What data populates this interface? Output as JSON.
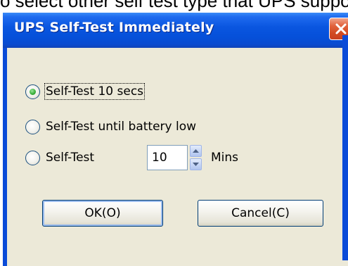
{
  "top_text": "o select other self test type that UPS support",
  "dialog": {
    "title": "UPS Self-Test Immediately",
    "close_icon": "close-x-icon"
  },
  "options": [
    {
      "label": "Self-Test 10 secs",
      "checked": true
    },
    {
      "label": "Self-Test until battery low",
      "checked": false
    },
    {
      "label": "Self-Test",
      "checked": false
    }
  ],
  "minutes": {
    "value": "10",
    "unit": "Mins"
  },
  "buttons": {
    "ok": "OK(O)",
    "cancel": "Cancel(C)"
  },
  "colors": {
    "titlebar": "#0a56e0",
    "window_bg": "#ece9d8",
    "close_button": "#d14b22",
    "radio_checked": "#3cb13c"
  }
}
